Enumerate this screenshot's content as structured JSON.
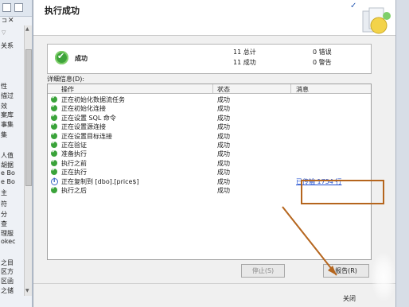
{
  "left_pane": {
    "labels": [
      "关系",
      "性",
      "描过",
      "效",
      "案库",
      "事集",
      "集",
      "人值",
      "胡据",
      "e Bo",
      "e Bo",
      "主",
      "符",
      "分",
      "查",
      "理服",
      "okec",
      "之目",
      "区方",
      "区函",
      "之储"
    ]
  },
  "dialog": {
    "title": "执行成功"
  },
  "summary": {
    "status": "成功",
    "total_label": "11 总计",
    "success_label": "11 成功",
    "error_label": "0 错误",
    "warning_label": "0 警告"
  },
  "details_label": "详细信息(D):",
  "table": {
    "headers": [
      "操作",
      "状态",
      "消息"
    ],
    "rows": [
      {
        "op": "正在初始化数据流任务",
        "status": "成功",
        "message": "",
        "icon": "check-icon"
      },
      {
        "op": "正在初始化连接",
        "status": "成功",
        "message": "",
        "icon": "check-icon"
      },
      {
        "op": "正在设置 SQL 命令",
        "status": "成功",
        "message": "",
        "icon": "check-icon"
      },
      {
        "op": "正在设置源连接",
        "status": "成功",
        "message": "",
        "icon": "check-icon"
      },
      {
        "op": "正在设置目标连接",
        "status": "成功",
        "message": "",
        "icon": "check-icon"
      },
      {
        "op": "正在验证",
        "status": "成功",
        "message": "",
        "icon": "check-icon"
      },
      {
        "op": "准备执行",
        "status": "成功",
        "message": "",
        "icon": "check-icon"
      },
      {
        "op": "执行之前",
        "status": "成功",
        "message": "",
        "icon": "check-icon"
      },
      {
        "op": "正在执行",
        "status": "成功",
        "message": "",
        "icon": "check-icon"
      },
      {
        "op": "正在复制到 [dbo].[price$]",
        "status": "成功",
        "message": "已传输 1754 行",
        "icon": "info-icon"
      },
      {
        "op": "执行之后",
        "status": "成功",
        "message": "",
        "icon": "check-icon"
      }
    ]
  },
  "buttons": {
    "stop": "停止(S)",
    "report": "报告(R)",
    "close": "关闭"
  },
  "colors": {
    "accent_link": "#1f4fd0",
    "callout": "#b5651d",
    "success": "#3aa33a"
  }
}
